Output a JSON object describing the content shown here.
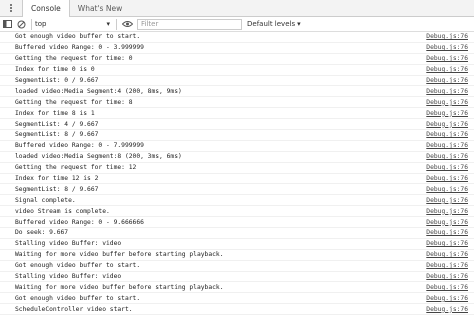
{
  "tabs": [
    {
      "label": "Console"
    },
    {
      "label": "What's New"
    }
  ],
  "toolbar": {
    "context": "top",
    "filter_placeholder": "Filter",
    "levels": "Default levels"
  },
  "logs": [
    {
      "text": "Got enough video buffer to start.",
      "source": "Debug.js:76"
    },
    {
      "text": "Buffered video Range: 0 - 3.999999",
      "source": "Debug.js:76"
    },
    {
      "text": "Getting the request for time: 0",
      "source": "Debug.js:76"
    },
    {
      "text": "Index for time 0 is 0",
      "source": "Debug.js:76"
    },
    {
      "text": "SegmentList: 0 / 9.667",
      "source": "Debug.js:76"
    },
    {
      "text": "loaded video:Media Segment:4 (200, 8ms, 9ms)",
      "source": "Debug.js:76"
    },
    {
      "text": "Getting the request for time: 8",
      "source": "Debug.js:76"
    },
    {
      "text": "Index for time 8 is 1",
      "source": "Debug.js:76"
    },
    {
      "text": "SegmentList: 4 / 9.667",
      "source": "Debug.js:76"
    },
    {
      "text": "SegmentList: 8 / 9.667",
      "source": "Debug.js:76"
    },
    {
      "text": "Buffered video Range: 0 - 7.999999",
      "source": "Debug.js:76"
    },
    {
      "text": "loaded video:Media Segment:8 (200, 3ms, 6ms)",
      "source": "Debug.js:76"
    },
    {
      "text": "Getting the request for time: 12",
      "source": "Debug.js:76"
    },
    {
      "text": "Index for time 12 is 2",
      "source": "Debug.js:76"
    },
    {
      "text": "SegmentList: 8 / 9.667",
      "source": "Debug.js:76"
    },
    {
      "text": "Signal complete.",
      "source": "Debug.js:76"
    },
    {
      "text": "video Stream is complete.",
      "source": "Debug.js:76"
    },
    {
      "text": "Buffered video Range: 0 - 9.666666",
      "source": "Debug.js:76"
    },
    {
      "text": "Do seek: 9.667",
      "source": "Debug.js:76"
    },
    {
      "text": "Stalling video Buffer: video",
      "source": "Debug.js:76"
    },
    {
      "text": "Waiting for more video buffer before starting playback.",
      "source": "Debug.js:76"
    },
    {
      "text": "Got enough video buffer to start.",
      "source": "Debug.js:76"
    },
    {
      "text": "Stalling video Buffer: video",
      "source": "Debug.js:76"
    },
    {
      "text": "Waiting for more video buffer before starting playback.",
      "source": "Debug.js:76"
    },
    {
      "text": "Got enough video buffer to start.",
      "source": "Debug.js:76"
    },
    {
      "text": "ScheduleController video start.",
      "source": "Debug.js:76"
    }
  ]
}
